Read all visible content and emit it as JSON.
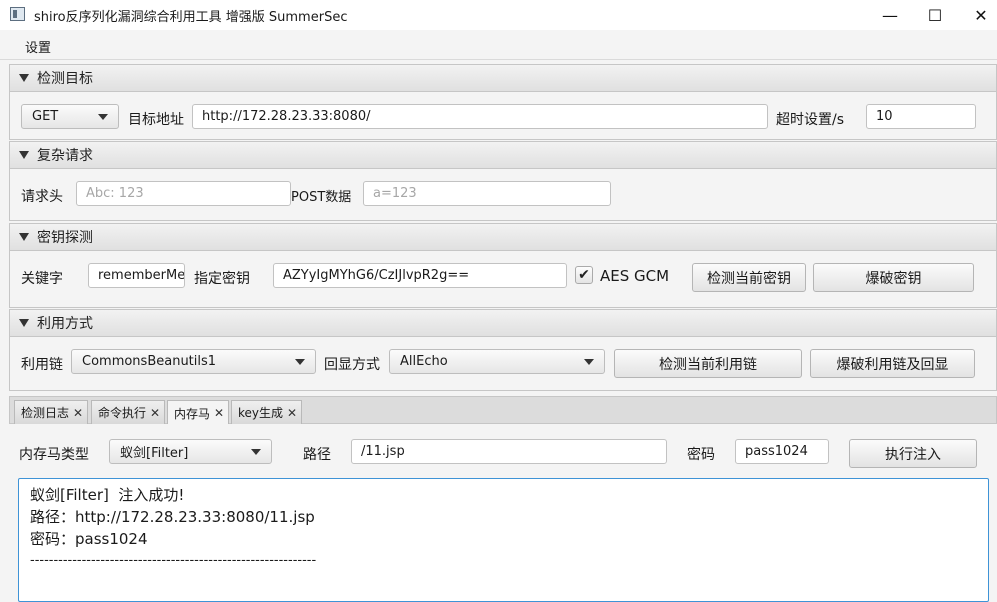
{
  "window": {
    "title": "shiro反序列化漏洞综合利用工具 增强版 SummerSec",
    "controls": {
      "minimize": "—",
      "maximize": "☐",
      "close": "✕"
    }
  },
  "menu": {
    "settings": "设置"
  },
  "target_section": {
    "title": "检测目标",
    "method": "GET",
    "url_label": "目标地址",
    "url_value": "http://172.28.23.33:8080/",
    "timeout_label": "超时设置/s",
    "timeout_value": "10"
  },
  "complex_section": {
    "title": "复杂请求",
    "headers_label": "请求头",
    "headers_placeholder": "Abc: 123",
    "post_label": "POST数据",
    "post_placeholder": "a=123"
  },
  "key_section": {
    "title": "密钥探测",
    "keyword_label": "关键字",
    "keyword_value": "rememberMe",
    "key_label": "指定密钥",
    "key_value": "AZYyIgMYhG6/CzIJlvpR2g==",
    "aes_gcm_label": "AES GCM",
    "aes_gcm_checked": true,
    "check_key_button": "检测当前密钥",
    "brute_key_button": "爆破密钥"
  },
  "exploit_section": {
    "title": "利用方式",
    "chain_label": "利用链",
    "chain_value": "CommonsBeanutils1",
    "echo_label": "回显方式",
    "echo_value": "AllEcho",
    "check_chain_button": "检测当前利用链",
    "brute_chain_button": "爆破利用链及回显"
  },
  "tabs": [
    {
      "label": "检测日志",
      "active": false
    },
    {
      "label": "命令执行",
      "active": false
    },
    {
      "label": "内存马",
      "active": true
    },
    {
      "label": "key生成",
      "active": false
    }
  ],
  "memshell": {
    "type_label": "内存马类型",
    "type_value": "蚁剑[Filter]",
    "path_label": "路径",
    "path_value": "/11.jsp",
    "password_label": "密码",
    "password_value": "pass1024",
    "inject_button": "执行注入",
    "output_lines": [
      "蚁剑[Filter]  注入成功!",
      "路径：http://172.28.23.33:8080/11.jsp",
      "密码：pass1024",
      "-------------------------------------------------------------"
    ]
  }
}
